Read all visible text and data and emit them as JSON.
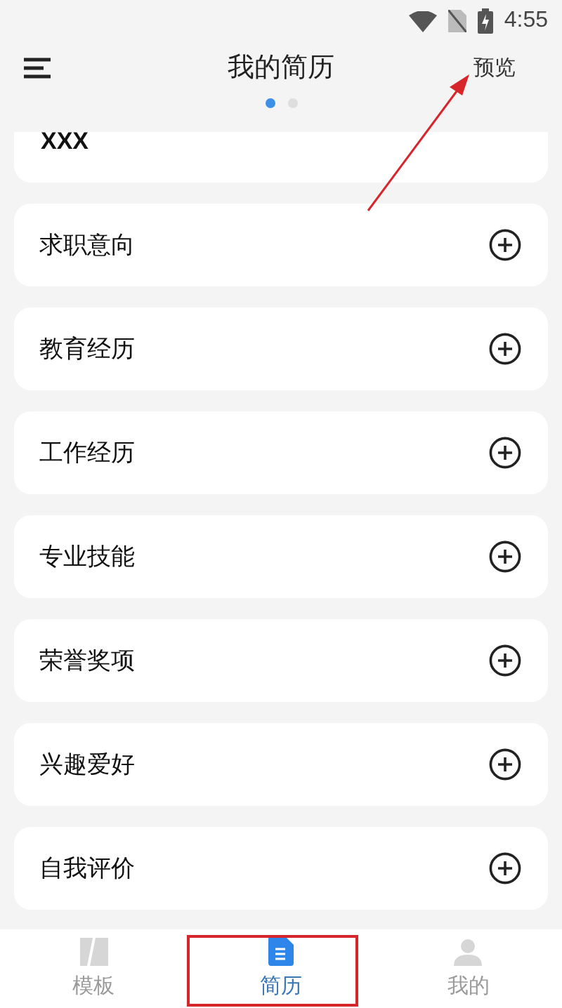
{
  "status_bar": {
    "time": "4:55"
  },
  "header": {
    "title": "我的简历",
    "action": "预览",
    "pages": [
      {
        "selected": true
      },
      {
        "selected": false
      }
    ]
  },
  "basic_card": {
    "name": "XXX"
  },
  "sections": [
    {
      "label": "求职意向"
    },
    {
      "label": "教育经历"
    },
    {
      "label": "工作经历"
    },
    {
      "label": "专业技能"
    },
    {
      "label": "荣誉奖项"
    },
    {
      "label": "兴趣爱好"
    },
    {
      "label": "自我评价"
    }
  ],
  "tab_bar": [
    {
      "label": "模板",
      "kind": "template",
      "selected": false,
      "highlighted": false
    },
    {
      "label": "简历",
      "kind": "resume",
      "selected": true,
      "highlighted": true
    },
    {
      "label": "我的",
      "kind": "profile",
      "selected": false,
      "highlighted": false
    }
  ]
}
